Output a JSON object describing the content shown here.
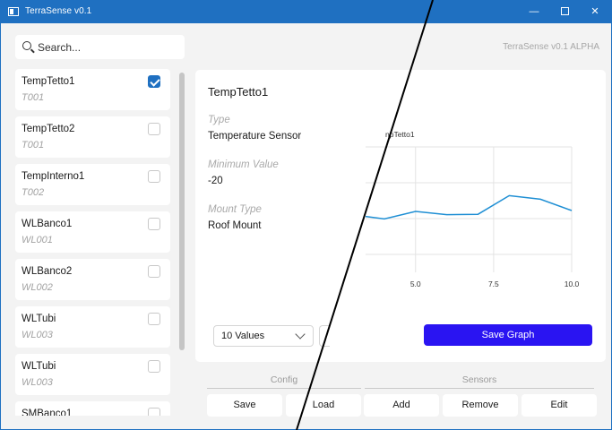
{
  "window": {
    "title": "TerraSense v0.1",
    "minimize_glyph": "—",
    "close_glyph": "✕"
  },
  "search": {
    "placeholder": "Search..."
  },
  "brand": "TerraSense v0.1 ALPHA",
  "sensors": [
    {
      "name": "TempTetto1",
      "id": "T001",
      "checked": true
    },
    {
      "name": "TempTetto2",
      "id": "T001",
      "checked": false
    },
    {
      "name": "TempInterno1",
      "id": "T002",
      "checked": false
    },
    {
      "name": "WLBanco1",
      "id": "WL001",
      "checked": false
    },
    {
      "name": "WLBanco2",
      "id": "WL002",
      "checked": false
    },
    {
      "name": "WLTubi",
      "id": "WL003",
      "checked": false
    },
    {
      "name": "WLTubi",
      "id": "WL003",
      "checked": false
    },
    {
      "name": "SMBanco1",
      "id": "",
      "checked": false
    }
  ],
  "detail": {
    "title": "TempTetto1",
    "type_label": "Type",
    "type_value": "Temperature Sensor",
    "min_label": "Minimum Value",
    "min_value": "-20",
    "mount_label": "Mount Type",
    "mount_value": "Roof Mount"
  },
  "chart_data": {
    "type": "line",
    "series": [
      {
        "name": "TempTetto1",
        "x": [
          3.4,
          4.0,
          5.0,
          6.0,
          7.0,
          8.0,
          9.0,
          10.0
        ],
        "y": [
          0.62,
          0.48,
          0.9,
          0.72,
          0.74,
          1.78,
          1.58,
          0.95
        ]
      }
    ],
    "xlim": [
      3.4,
      10.0
    ],
    "ylim": [
      -2.5,
      4.5
    ],
    "xticks": [
      "5.0",
      "7.5",
      "10.0"
    ],
    "xtick_values": [
      5.0,
      7.5,
      10.0
    ],
    "ygrid": [
      -1.5,
      0.5,
      2.5
    ],
    "grid": true,
    "legend_text": "npTetto1",
    "line_color": "#1f8fd4"
  },
  "controls": {
    "values_select": "10 Values",
    "save_graph": "Save Graph"
  },
  "groups": {
    "config": "Config",
    "sensors": "Sensors"
  },
  "buttons": {
    "save": "Save",
    "load": "Load",
    "add": "Add",
    "remove": "Remove",
    "edit": "Edit"
  },
  "colors": {
    "accent": "#1f70c1",
    "primary_button": "#2a14f2"
  }
}
